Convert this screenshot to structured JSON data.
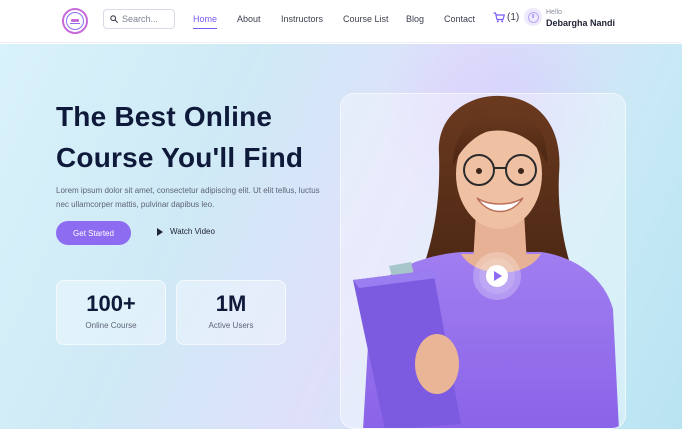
{
  "nav": {
    "search_placeholder": "Search...",
    "links": [
      "Home",
      "About",
      "Instructors",
      "Course List",
      "Blog",
      "Contact"
    ],
    "active_link": "Home",
    "cart_count": "(1)",
    "greeting": "Hello",
    "user_name": "Debargha Nandi"
  },
  "hero": {
    "title": "The Best Online Course You'll Find",
    "description": "Lorem ipsum dolor sit amet, consectetur adipiscing elit. Ut elit tellus, luctus nec ullamcorper mattis, pulvinar dapibus leo.",
    "primary_button": "Get Started",
    "secondary_button": "Watch Video",
    "stats": [
      {
        "value": "100+",
        "label": "Online Course"
      },
      {
        "value": "1M",
        "label": "Active Users"
      }
    ]
  },
  "colors": {
    "accent": "#8d6cf2",
    "heading": "#0f1a3a",
    "body_text": "#5d6478"
  },
  "icons": [
    "logo-icon",
    "search-icon",
    "cart-icon",
    "user-avatar-icon",
    "play-icon",
    "video-play-icon"
  ]
}
